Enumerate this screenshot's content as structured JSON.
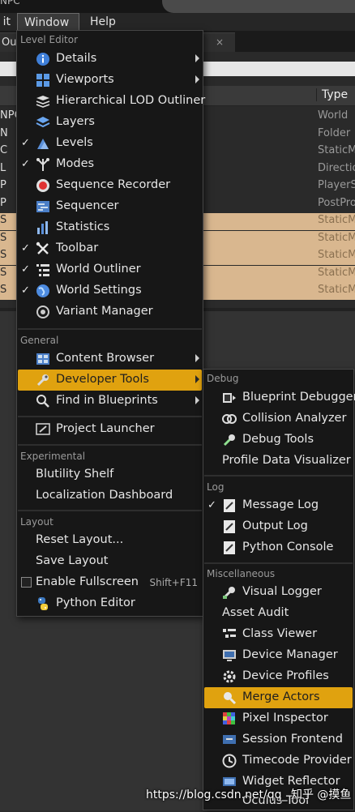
{
  "titlebar": {
    "text": "NPC"
  },
  "menubar": {
    "edit": "it",
    "window": "Window",
    "help": "Help"
  },
  "outliner_tab": {
    "label": "Ou",
    "close": "×"
  },
  "outliner": {
    "type_header": "Type",
    "rows": [
      {
        "label": "NPC",
        "type": "World",
        "selected": false
      },
      {
        "label": "N",
        "type": "Folder",
        "selected": false
      },
      {
        "label": "C",
        "type": "StaticM",
        "selected": false
      },
      {
        "label": "L",
        "type": "Directio",
        "selected": false
      },
      {
        "label": "P",
        "type": "PlayerS",
        "selected": false
      },
      {
        "label": "P",
        "type": "PostPro",
        "selected": false
      },
      {
        "label": "S",
        "type": "StaticM",
        "selected": true
      },
      {
        "label": "S",
        "type": "StaticM",
        "selected": true
      },
      {
        "label": "S",
        "type": "StaticM",
        "selected": true
      },
      {
        "label": "S",
        "type": "StaticM",
        "selected": true
      },
      {
        "label": "S",
        "type": "StaticM",
        "selected": true
      }
    ]
  },
  "window_menu": {
    "sections": {
      "level_editor": "Level Editor",
      "general": "General",
      "experimental": "Experimental",
      "layout": "Layout"
    },
    "items": {
      "details": "Details",
      "viewports": "Viewports",
      "hlod": "Hierarchical LOD Outliner",
      "layers": "Layers",
      "levels": "Levels",
      "modes": "Modes",
      "sequence_recorder": "Sequence Recorder",
      "sequencer": "Sequencer",
      "statistics": "Statistics",
      "toolbar": "Toolbar",
      "world_outliner": "World Outliner",
      "world_settings": "World Settings",
      "variant_manager": "Variant Manager",
      "content_browser": "Content Browser",
      "developer_tools": "Developer Tools",
      "find_in_blueprints": "Find in Blueprints",
      "project_launcher": "Project Launcher",
      "blutility_shelf": "Blutility Shelf",
      "localization_dashboard": "Localization Dashboard",
      "reset_layout": "Reset Layout...",
      "save_layout": "Save Layout",
      "enable_fullscreen": "Enable Fullscreen",
      "fullscreen_shortcut": "Shift+F11",
      "python_editor": "Python Editor"
    },
    "check": "✓"
  },
  "developer_tools_menu": {
    "sections": {
      "debug": "Debug",
      "log": "Log",
      "misc": "Miscellaneous"
    },
    "items": {
      "blueprint_debugger": "Blueprint Debugger",
      "collision_analyzer": "Collision Analyzer",
      "debug_tools": "Debug Tools",
      "profile_data_visualizer": "Profile Data Visualizer",
      "message_log": "Message Log",
      "output_log": "Output Log",
      "python_console": "Python Console",
      "visual_logger": "Visual Logger",
      "asset_audit": "Asset Audit",
      "class_viewer": "Class Viewer",
      "device_manager": "Device Manager",
      "device_profiles": "Device Profiles",
      "merge_actors": "Merge Actors",
      "pixel_inspector": "Pixel Inspector",
      "session_frontend": "Session Frontend",
      "timecode_provider": "Timecode Provider",
      "widget_reflector": "Widget Reflector",
      "oculus_tool": "Oculus Tool"
    }
  },
  "colors": {
    "highlight": "#e0a20f",
    "selection_row": "#d9b78f",
    "menu_bg": "#171717"
  },
  "watermark": "https://blog.csdn.net/qq_  知乎 @摸鱼"
}
